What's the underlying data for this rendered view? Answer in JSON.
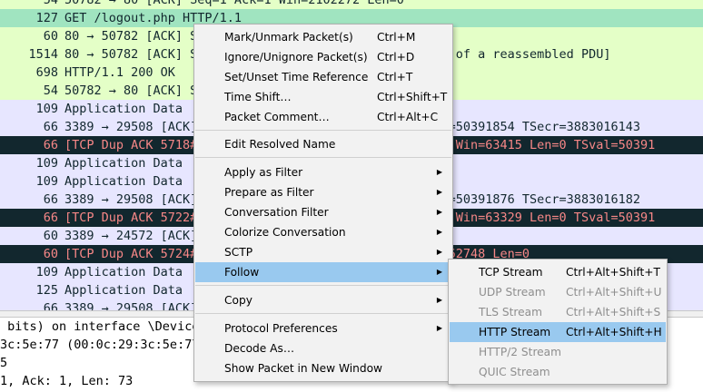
{
  "packets": [
    {
      "len": "54",
      "info": "50782 → 80 [ACK] Seq=1 Ack=1 Win=2102272 Len=0"
    },
    {
      "len": "127",
      "info": "GET /logout.php HTTP/1.1"
    },
    {
      "len": "60",
      "info": "80 → 50782 [ACK] S"
    },
    {
      "len": "1514",
      "info": "80 → 50782 [ACK] S                           segment of a reassembled PDU]"
    },
    {
      "len": "698",
      "info": "HTTP/1.1 200 OK"
    },
    {
      "len": "54",
      "info": "50782 → 80 [ACK] S"
    },
    {
      "len": "109",
      "info": "Application Data"
    },
    {
      "len": "66",
      "info": "3389 → 29508 [ACK]                          =0 TSval=50391854 TSecr=3883016143"
    },
    {
      "len": "66",
      "info": "[TCP Dup ACK 5718#                          ck=45095 Win=63415 Len=0 TSval=50391"
    },
    {
      "len": "109",
      "info": "Application Data"
    },
    {
      "len": "109",
      "info": "Application Data"
    },
    {
      "len": "66",
      "info": "3389 → 29508 [ACK]                          =0 TSval=50391876 TSecr=3883016182"
    },
    {
      "len": "66",
      "info": "[TCP Dup ACK 5722#                          ck=45181 Win=63329 Len=0 TSval=50391"
    },
    {
      "len": "60",
      "info": "3389 → 24572 [ACK]"
    },
    {
      "len": "60",
      "info": "[TCP Dup ACK 5724#                          253 Win=62748 Len=0"
    },
    {
      "len": "109",
      "info": "Application Data"
    },
    {
      "len": "125",
      "info": "Application Data"
    },
    {
      "len": "66",
      "info": "3389 → 29508 [ACK]                                                         2606"
    }
  ],
  "details": [
    " bits) on interface \\Device",
    "3c:5e:77 (00:0c:29:3c:5e:77",
    "5",
    "1, Ack: 1, Len: 73"
  ],
  "context_menu": [
    {
      "label": "Mark/Unmark Packet(s)",
      "shortcut": "Ctrl+M"
    },
    {
      "label": "Ignore/Unignore Packet(s)",
      "shortcut": "Ctrl+D"
    },
    {
      "label": "Set/Unset Time Reference",
      "shortcut": "Ctrl+T"
    },
    {
      "label": "Time Shift…",
      "shortcut": "Ctrl+Shift+T"
    },
    {
      "label": "Packet Comment…",
      "shortcut": "Ctrl+Alt+C"
    },
    {
      "label": "Edit Resolved Name",
      "shortcut": ""
    },
    {
      "label": "Apply as Filter",
      "shortcut": ""
    },
    {
      "label": "Prepare as Filter",
      "shortcut": ""
    },
    {
      "label": "Conversation Filter",
      "shortcut": ""
    },
    {
      "label": "Colorize Conversation",
      "shortcut": ""
    },
    {
      "label": "SCTP",
      "shortcut": ""
    },
    {
      "label": "Follow",
      "shortcut": ""
    },
    {
      "label": "Copy",
      "shortcut": ""
    },
    {
      "label": "Protocol Preferences",
      "shortcut": ""
    },
    {
      "label": "Decode As…",
      "shortcut": ""
    },
    {
      "label": "Show Packet in New Window",
      "shortcut": ""
    }
  ],
  "follow_submenu": [
    {
      "label": "TCP Stream",
      "shortcut": "Ctrl+Alt+Shift+T"
    },
    {
      "label": "UDP Stream",
      "shortcut": "Ctrl+Alt+Shift+U"
    },
    {
      "label": "TLS Stream",
      "shortcut": "Ctrl+Alt+Shift+S"
    },
    {
      "label": "HTTP Stream",
      "shortcut": "Ctrl+Alt+Shift+H"
    },
    {
      "label": "HTTP/2 Stream",
      "shortcut": ""
    },
    {
      "label": "QUIC Stream",
      "shortcut": ""
    }
  ],
  "colors": {
    "row_green": "#e4ffc7",
    "row_blue": "#e7e6ff",
    "row_selected": "#a0e4c0",
    "row_dark_bg": "#12272e",
    "row_dark_fg": "#f78787",
    "menu_highlight": "#99c9ef"
  }
}
